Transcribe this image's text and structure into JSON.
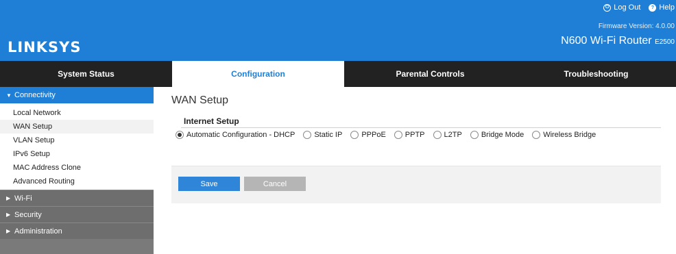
{
  "header": {
    "logo": "LINKSYS",
    "logout_label": "Log Out",
    "help_label": "Help",
    "firmware": "Firmware Version: 4.0.00",
    "model": "N600 Wi-Fi Router",
    "model_code": "E2500",
    "color": "#1f7fd6"
  },
  "tabs": [
    {
      "label": "System Status"
    },
    {
      "label": "Configuration",
      "active": true
    },
    {
      "label": "Parental Controls"
    },
    {
      "label": "Troubleshooting"
    }
  ],
  "sidebar": {
    "connectivity": {
      "label": "Connectivity",
      "items": [
        {
          "label": "Local Network"
        },
        {
          "label": "WAN Setup",
          "active": true
        },
        {
          "label": "VLAN Setup"
        },
        {
          "label": "IPv6 Setup"
        },
        {
          "label": "MAC Address Clone"
        },
        {
          "label": "Advanced Routing"
        }
      ]
    },
    "sections": [
      {
        "label": "Wi-Fi"
      },
      {
        "label": "Security"
      },
      {
        "label": "Administration"
      }
    ]
  },
  "main": {
    "title": "WAN Setup",
    "section_title": "Internet Setup",
    "radio_options": [
      {
        "label": "Automatic Configuration - DHCP",
        "selected": true
      },
      {
        "label": "Static IP"
      },
      {
        "label": "PPPoE"
      },
      {
        "label": "PPTP"
      },
      {
        "label": "L2TP"
      },
      {
        "label": "Bridge Mode"
      },
      {
        "label": "Wireless Bridge"
      }
    ],
    "save_label": "Save",
    "cancel_label": "Cancel"
  }
}
